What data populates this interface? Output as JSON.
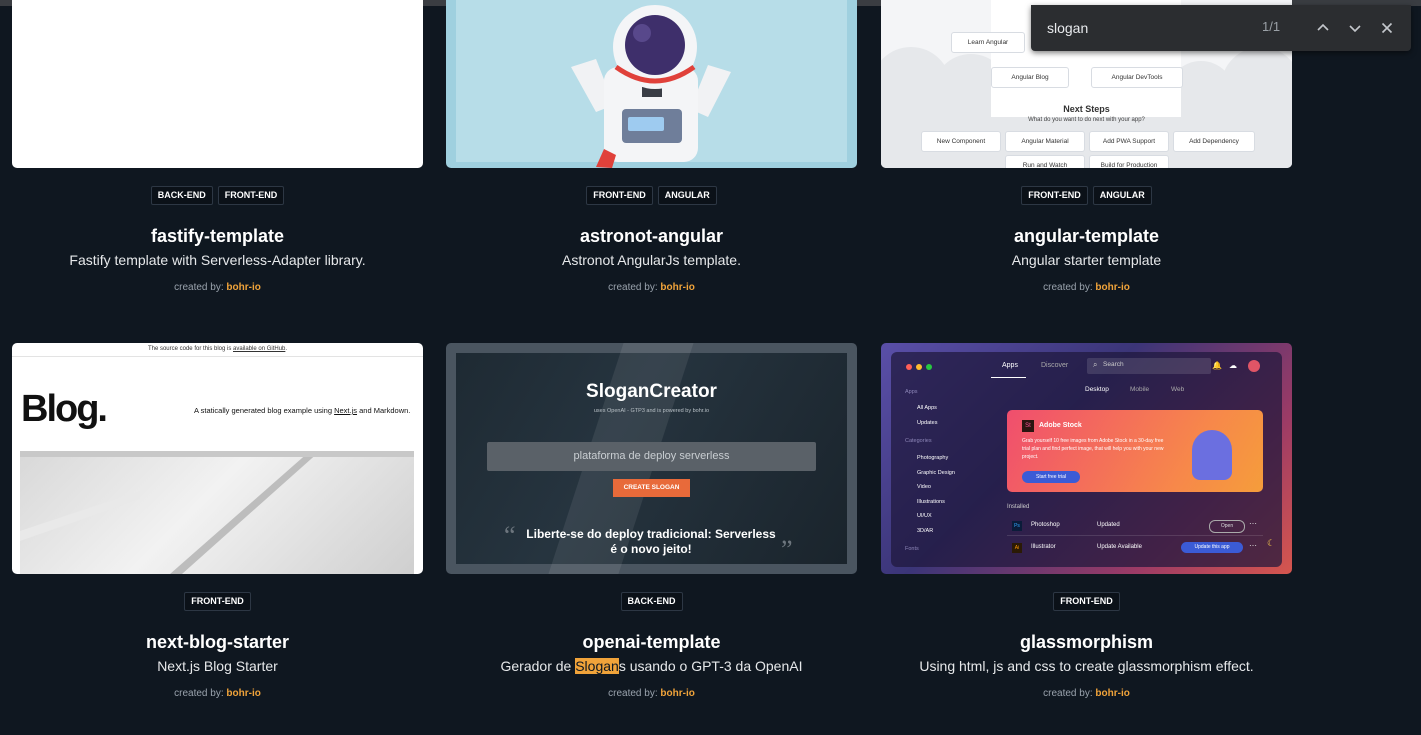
{
  "find_bar": {
    "query": "slogan",
    "count": "1/1"
  },
  "cards": [
    {
      "tags": [
        "BACK-END",
        "FRONT-END"
      ],
      "title": "fastify-template",
      "description": "Fastify template with Serverless-Adapter library.",
      "created_by_label": "created by:",
      "author": "bohr-io"
    },
    {
      "tags": [
        "FRONT-END",
        "ANGULAR"
      ],
      "title": "astronot-angular",
      "description": "Astronot AngularJs template.",
      "created_by_label": "created by:",
      "author": "bohr-io"
    },
    {
      "tags": [
        "FRONT-END",
        "ANGULAR"
      ],
      "title": "angular-template",
      "description": "Angular starter template",
      "created_by_label": "created by:",
      "author": "bohr-io",
      "preview": {
        "links": [
          "Learn Angular",
          "Angular Blog",
          "Angular DevTools"
        ],
        "heading": "Next Steps",
        "subheading": "What do you want to do next with your app?",
        "actions": [
          "New Component",
          "Angular Material",
          "Add PWA Support",
          "Add Dependency",
          "Run and Watch",
          "Build for Production"
        ]
      }
    },
    {
      "tags": [
        "FRONT-END"
      ],
      "title": "next-blog-starter",
      "description": "Next.js Blog Starter",
      "created_by_label": "created by:",
      "author": "bohr-io",
      "preview": {
        "notice_prefix": "The source code for this blog is ",
        "notice_link": "available on GitHub",
        "notice_suffix": ".",
        "heading": "Blog.",
        "tagline_prefix": "A statically generated blog example using ",
        "tagline_link": "Next.js",
        "tagline_suffix": " and Markdown."
      }
    },
    {
      "tags": [
        "BACK-END"
      ],
      "title": "openai-template",
      "description_before": "Gerador de ",
      "description_highlight": "Slogan",
      "description_after": "s usando o GPT-3 da OpenAI",
      "created_by_label": "created by:",
      "author": "bohr-io",
      "preview": {
        "heading": "SloganCreator",
        "subheading": "uses OpenAI - GTP3 and is powered by bohr.io",
        "input_value": "plataforma de deploy serverless",
        "button": "CREATE SLOGAN",
        "quote": "Liberte-se do deploy tradicional: Serverless é o novo jeito!"
      }
    },
    {
      "tags": [
        "FRONT-END"
      ],
      "title": "glassmorphism",
      "description": "Using html, js and css to create glassmorphism effect.",
      "created_by_label": "created by:",
      "author": "bohr-io",
      "preview": {
        "tabs": [
          "Apps",
          "Discover"
        ],
        "search": "Search",
        "subtabs": [
          "Desktop",
          "Mobile",
          "Web"
        ],
        "sidebar": [
          "Apps",
          "All Apps",
          "Updates",
          "Categories",
          "Photography",
          "Graphic Design",
          "Video",
          "Illustrations",
          "UI/UX",
          "3D/AR",
          "Fonts"
        ],
        "banner_title": "Adobe Stock",
        "banner_text": "Grab yourself 10 free images from Adobe Stock in a 30-day free trial plan and find perfect image, that will help you with your new project.",
        "banner_button": "Start free trial",
        "installed": "Installed",
        "apps": [
          {
            "name": "Photoshop",
            "status": "Updated",
            "action": "Open"
          },
          {
            "name": "Illustrator",
            "status": "Update Available",
            "action": "Update this app"
          }
        ]
      }
    }
  ]
}
